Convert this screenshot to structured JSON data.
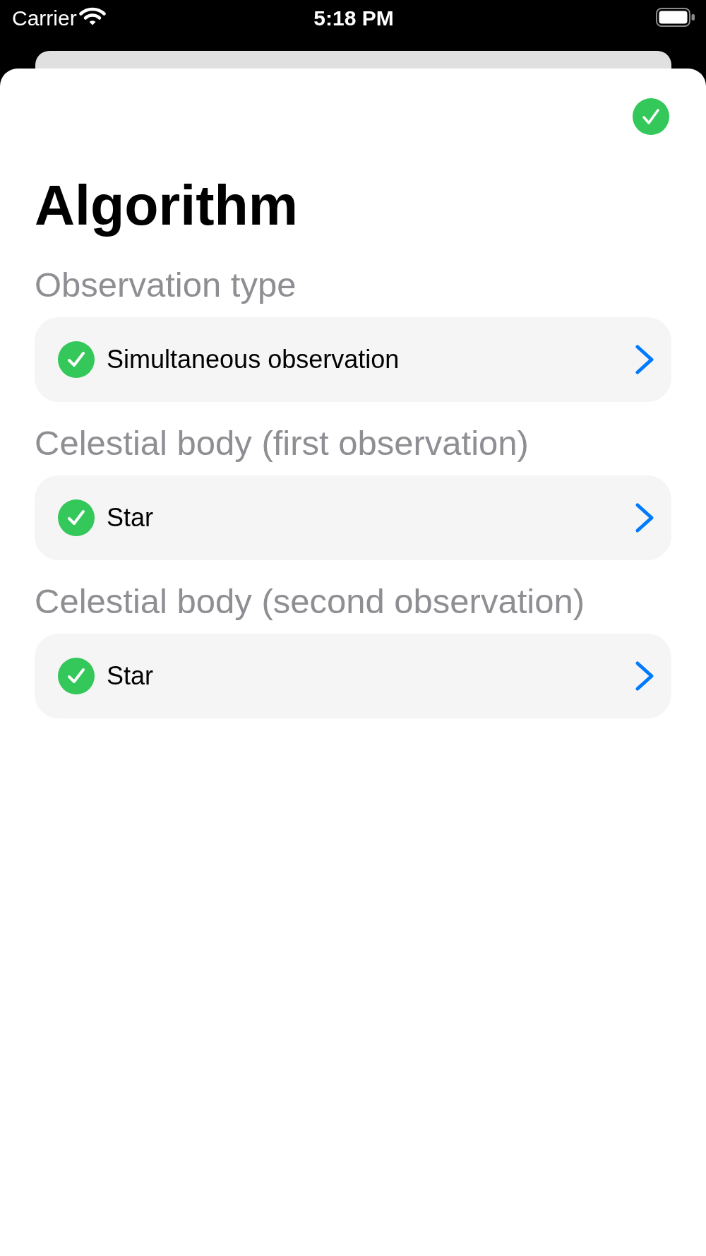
{
  "status_bar": {
    "carrier": "Carrier",
    "time": "5:18 PM"
  },
  "sheet": {
    "title": "Algorithm"
  },
  "sections": [
    {
      "header": "Observation type",
      "value": "Simultaneous observation",
      "checked": true
    },
    {
      "header": "Celestial body (first observation)",
      "value": "Star",
      "checked": true
    },
    {
      "header": "Celestial body (second observation)",
      "value": "Star",
      "checked": true
    }
  ]
}
